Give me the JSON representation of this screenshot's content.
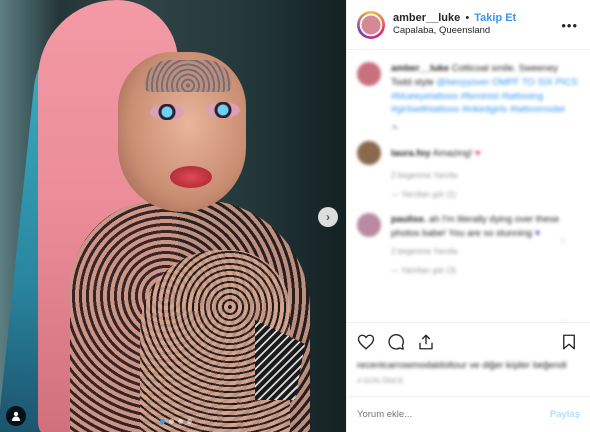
{
  "post": {
    "username": "amber__luke",
    "separator": "•",
    "follow_label": "Takip Et",
    "location": "Capalaba, Queensland",
    "more_glyph": "•••"
  },
  "media": {
    "next_glyph": "›",
    "dots": [
      true,
      false,
      false,
      false
    ],
    "user_tag_glyph": "●"
  },
  "comments": [
    {
      "author": "amber__luke",
      "text": "Cotticoal smile. Sweeney Todd style",
      "hashtags": "@bevyyover OMPF TO SIX PICS #blueeyetattoos #feminist #tattooing #girlswithtattoos #inkedgirls #tattoomodel",
      "avatar_color": "#c9707e"
    },
    {
      "author": "laura.foy",
      "text": "Amazing!",
      "meta": "2 begenme   Yanıtla",
      "reply": "—  Yanıtları gör (1)",
      "avatar_color": "#8a6a4e"
    },
    {
      "author": "paulise.",
      "text": "ah I'm literally dying over these photos babe! You are so stunning",
      "meta": "2 begenme   Yanıtla",
      "reply": "—  Yanıtları gör (3)",
      "avatar_color": "#b98aa0"
    }
  ],
  "likes_text": "recentcarrowmodaldoltour ve diğer kişiler beğendi",
  "time_ago": "4 GÜN ÖNCE",
  "add_comment": {
    "placeholder": "Yorum ekle...",
    "post_label": "Paylaş"
  },
  "icons": {
    "heart": "heart-icon",
    "comment": "comment-icon",
    "share": "share-icon",
    "bookmark": "bookmark-icon"
  },
  "colors": {
    "link_blue": "#3897f0",
    "muted": "#999999",
    "post_disabled": "#b2dffc"
  }
}
